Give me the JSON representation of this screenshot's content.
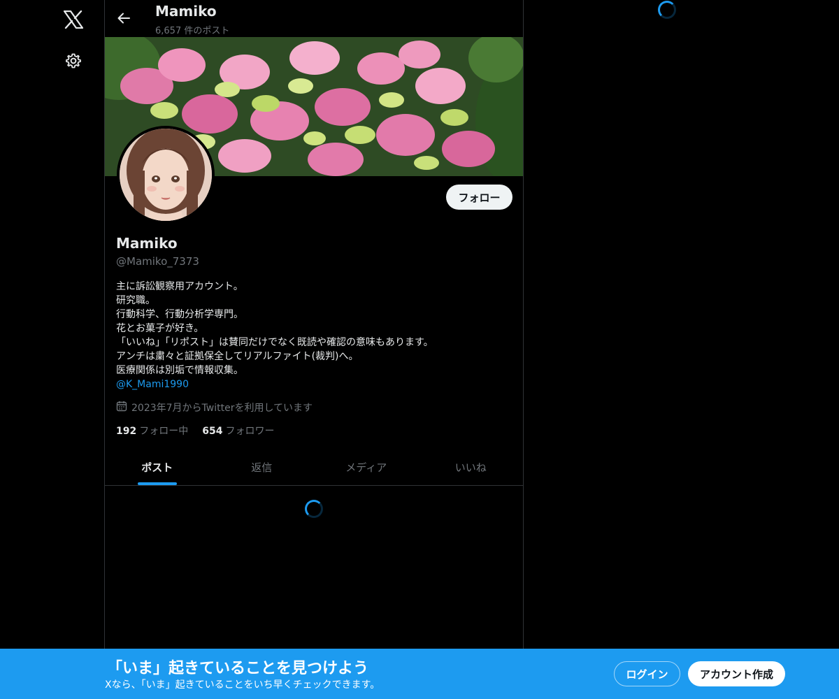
{
  "nav": {
    "logo_icon": "x-logo-icon",
    "settings_icon": "gear-icon"
  },
  "header": {
    "name": "Mamiko",
    "post_count": "6,657 件のポスト",
    "back_icon": "arrow-left-icon"
  },
  "profile": {
    "follow_label": "フォロー",
    "display_name": "Mamiko",
    "handle": "@Mamiko_7373",
    "bio_lines": [
      "主に訴訟観察用アカウント。",
      "研究職。",
      "行動科学、行動分析学専門。",
      "花とお菓子が好き。",
      "「いいね」「リポスト」は賛同だけでなく既読や確認の意味もあります。",
      "アンチは粛々と証拠保全してリアルファイト(裁判)へ。",
      "医療関係は別垢で情報収集。"
    ],
    "bio_mention": "@K_Mami1990",
    "joined": "2023年7月からTwitterを利用しています",
    "following_count": "192",
    "following_label": "フォロー中",
    "followers_count": "654",
    "followers_label": "フォロワー"
  },
  "tabs": [
    {
      "label": "ポスト",
      "active": true
    },
    {
      "label": "返信",
      "active": false
    },
    {
      "label": "メディア",
      "active": false
    },
    {
      "label": "いいね",
      "active": false
    }
  ],
  "bottom_bar": {
    "title": "「いま」起きていることを見つけよう",
    "subtitle": "Xなら、「いま」起きていることをいち早くチェックできます。",
    "login_label": "ログイン",
    "signup_label": "アカウント作成"
  },
  "colors": {
    "accent": "#1d9bf0",
    "background": "#000000",
    "text_primary": "#e7e9ea",
    "text_secondary": "#71767b",
    "border": "#2f3336"
  }
}
